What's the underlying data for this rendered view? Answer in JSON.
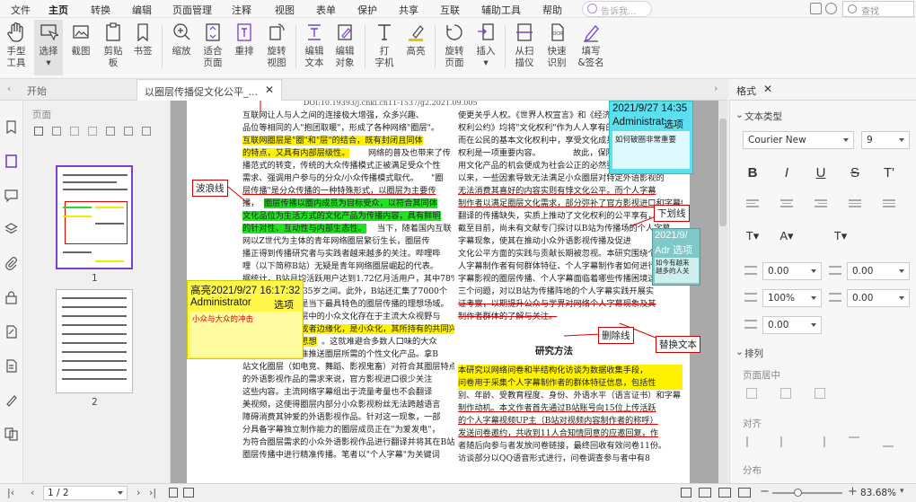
{
  "menu": [
    "文件",
    "主页",
    "转换",
    "编辑",
    "页面管理",
    "注释",
    "视图",
    "表单",
    "保护",
    "共享",
    "互联",
    "辅助工具",
    "帮助"
  ],
  "active_menu": "主页",
  "assistant_placeholder": "告诉我...",
  "search_placeholder": "查找",
  "toolbar": {
    "hand": [
      "手型",
      "工具"
    ],
    "select": [
      "选择"
    ],
    "screenshot": [
      "截图"
    ],
    "clipboard": [
      "剪贴",
      "板"
    ],
    "bookmark": [
      "书签"
    ],
    "zoom": [
      "缩放"
    ],
    "fit_page": [
      "适合",
      "页面"
    ],
    "reflow": [
      "重排"
    ],
    "rotate_view": [
      "旋转",
      "视图"
    ],
    "edit_text": [
      "编辑",
      "文本"
    ],
    "edit_object": [
      "编辑",
      "对象"
    ],
    "typewriter": [
      "打",
      "字机"
    ],
    "highlight": [
      "高亮"
    ],
    "rotate_page": [
      "旋转",
      "页面"
    ],
    "insert": [
      "插入"
    ],
    "scan": [
      "从扫",
      "描仪"
    ],
    "ocr": [
      "快速",
      "识别"
    ],
    "fill_sign": [
      "填写",
      "&签名"
    ]
  },
  "tabs": {
    "start": "开始",
    "doc": "以圈层传播促文化公平_..."
  },
  "right_tab": "格式",
  "thumbs": {
    "panel_title": "页面",
    "page1": "1",
    "page2": "2"
  },
  "page": {
    "header": "DOI:10.19393/j.cnki.cn11-1537/g2.2021.09.005",
    "left_col": [
      "互联网让人与人之间的连接极大增强，众多兴趣、",
      "品位等相同的人\"抱团取暖\"，形成了各种网络\"圈层\"。",
      "互联网圈层是\"圈\"和\"层\"的结合，既有封闭且同体",
      "的特点，又具有内部层级性。",
      "网络的普及也带来了传",
      "播范式的转变，传统的大众传播模式正被满足受众个性",
      "需求、强调用户参与的分众/小众传播模式取代。",
      "\"圈",
      "层传播\"是分众传播的一种特殊形式，以圈层为主要传",
      "播，",
      "圈层传播以圈内成员为目标受众，以符合其同体",
      "文化品位为生活方式的文化产品为传播内容，具有鲜明",
      "的针对性、互动性与内部生态性。",
      "当下，随着国内互联",
      "网以Z世代为主体的青年网络圈层繁衍生长，圈层传",
      "播正得到传播研究者与实践者越来越多的关注。哔哩哔",
      "哩（以下简称B站）无疑是青年网络圈层崛起的代表。",
      "据统计，B站月均活跃用户达到1.72亿月活用户，其中78%的用",
      "户年龄段为18至35岁之间。此外，B站还汇集了7000个",
      "核心文化圈层，是当下最具特色的圈层传播的理想场域。",
      "近年来，网络圈层中的小众文化存在于主流大众视野与",
      "之外，一些圈层或者边缘化，是小众化，其所持有的共同兴趣与",
      "品位与主流文化思想",
      "。这就难避合多数人口味的大众",
      "传播往往无法精准推送圈层所需的个性文化产品。拿B",
      "站文化圈层（如电竞、舞蹈、影视鬼畜）对符合其圈层特点",
      "的外语影视作品的需求来说，官方影视进口很少关注",
      "这些内容。主流网络字幕组出于流量考量也不会翻译",
      "美视频，这使得圈层内部分小众影视粉丝无法跨越语言",
      "障碍消费其钟爱的外语影视作品。针对这一现象，一部",
      "分具备字幕独立制作能力的圈层成员正在\"为爱发电\"，",
      "为符合圈层需求的小众外语影视作品进行翻译并将其在B站的",
      "圈层传播中进行精准传播。笔者以\"个人字幕\"为关键词"
    ],
    "right_col": [
      "使更关乎人权。《世界人权宣言》和《经济、社会和文化",
      "权利公约》均将\"文化权利\"作为人人享有的基本权利。",
      "而在公民的基本文化权利中，享受文化成果即文化享受",
      "权利是一项重要内容。",
      "故此，保障个体平等获取与享",
      "用文化产品的机会便成为社会公正的必然要求。但长期",
      "以来，一些因素导致无法满足小众圈层对特定外语影视的",
      "无法消费其喜好的内容实则有悖文化公平。而个人字幕",
      "制作者以满足圈层文化需求，部分弥补了官方影视进口和字幕组",
      "翻译的传播缺失，实质上推动了文化权利的公平享有，扩",
      "截至目前，尚未有文献专门探讨以B站为传播场的个人字幕",
      "字幕现象，使其在推动小众外语影视传播及促进",
      "文化公平方面的实践与贡献长期被忽视。本研究围绕个",
      "人字幕制作者有何群体特征、个人字幕制作者如何进行",
      "字幕影视的圈层传播、个人字幕面临着哪些传播困境这",
      "三个问题，对以B站为传播阵地的个人字幕实践开展实",
      "证考察，以期提升公众与学界对网络个人字幕现象及其",
      "制作者群体的了解与关注。",
      "研究方法",
      "本研究以网络问卷和半结构化访谈为数据收集手段，",
      "问卷用于采集个人字幕制作者的群体特征信息，包括性",
      "别、年龄、受教育程度、身份、外语水平（语言证书）和字幕",
      "制作动机。本文作者首先通过B站账号向15位上传活跃",
      "的个人字幕视频UP主（B站对视频内容制作者的称呼）",
      "发送问卷邀约，共收到11人合知情同意的应邀回复，作",
      "者随后向参与者发放问卷链接，最终回收有效问卷11份。",
      "访谈部分以QQ语音形式进行，问卷调查参与者中有8"
    ]
  },
  "annotations": {
    "wavy_label": "波浪线",
    "underline_label": "下划线",
    "strike_label": "删除线",
    "replace_label": "替换文本",
    "note1": {
      "date": "2021/9/27 14:35",
      "author": "Administrat",
      "opt": "选项",
      "text": "如何破圈非常重要"
    },
    "note2": {
      "date": "2021/9/27 16:17:32",
      "prefix": "高亮",
      "author": "Administrator",
      "opt": "选项",
      "text": "小众与大众的冲击"
    },
    "note3": {
      "date": "2021/9/",
      "author": "Adr",
      "opt": "选项",
      "text": [
        "如今有越来",
        "越多的人关"
      ]
    }
  },
  "format_panel": {
    "section_text_type": "文本类型",
    "font": "Courier New",
    "size": "9",
    "spacing_values": [
      "0.00",
      "0.00",
      "100%",
      "0.00",
      "0.00"
    ],
    "section_arrange": "排列",
    "page_center": "页面居中",
    "align": "对齐",
    "distribute": "分布"
  },
  "status": {
    "page": "1 / 2",
    "zoom": "83.68%"
  },
  "colors": {
    "accent": "#7a3fd0",
    "highlight_yellow": "#fff200",
    "highlight_green": "#22e022",
    "note_cyan": "#5ce0f0",
    "note_yellow": "#fff64a",
    "note_teal": "#7ec8c8"
  }
}
